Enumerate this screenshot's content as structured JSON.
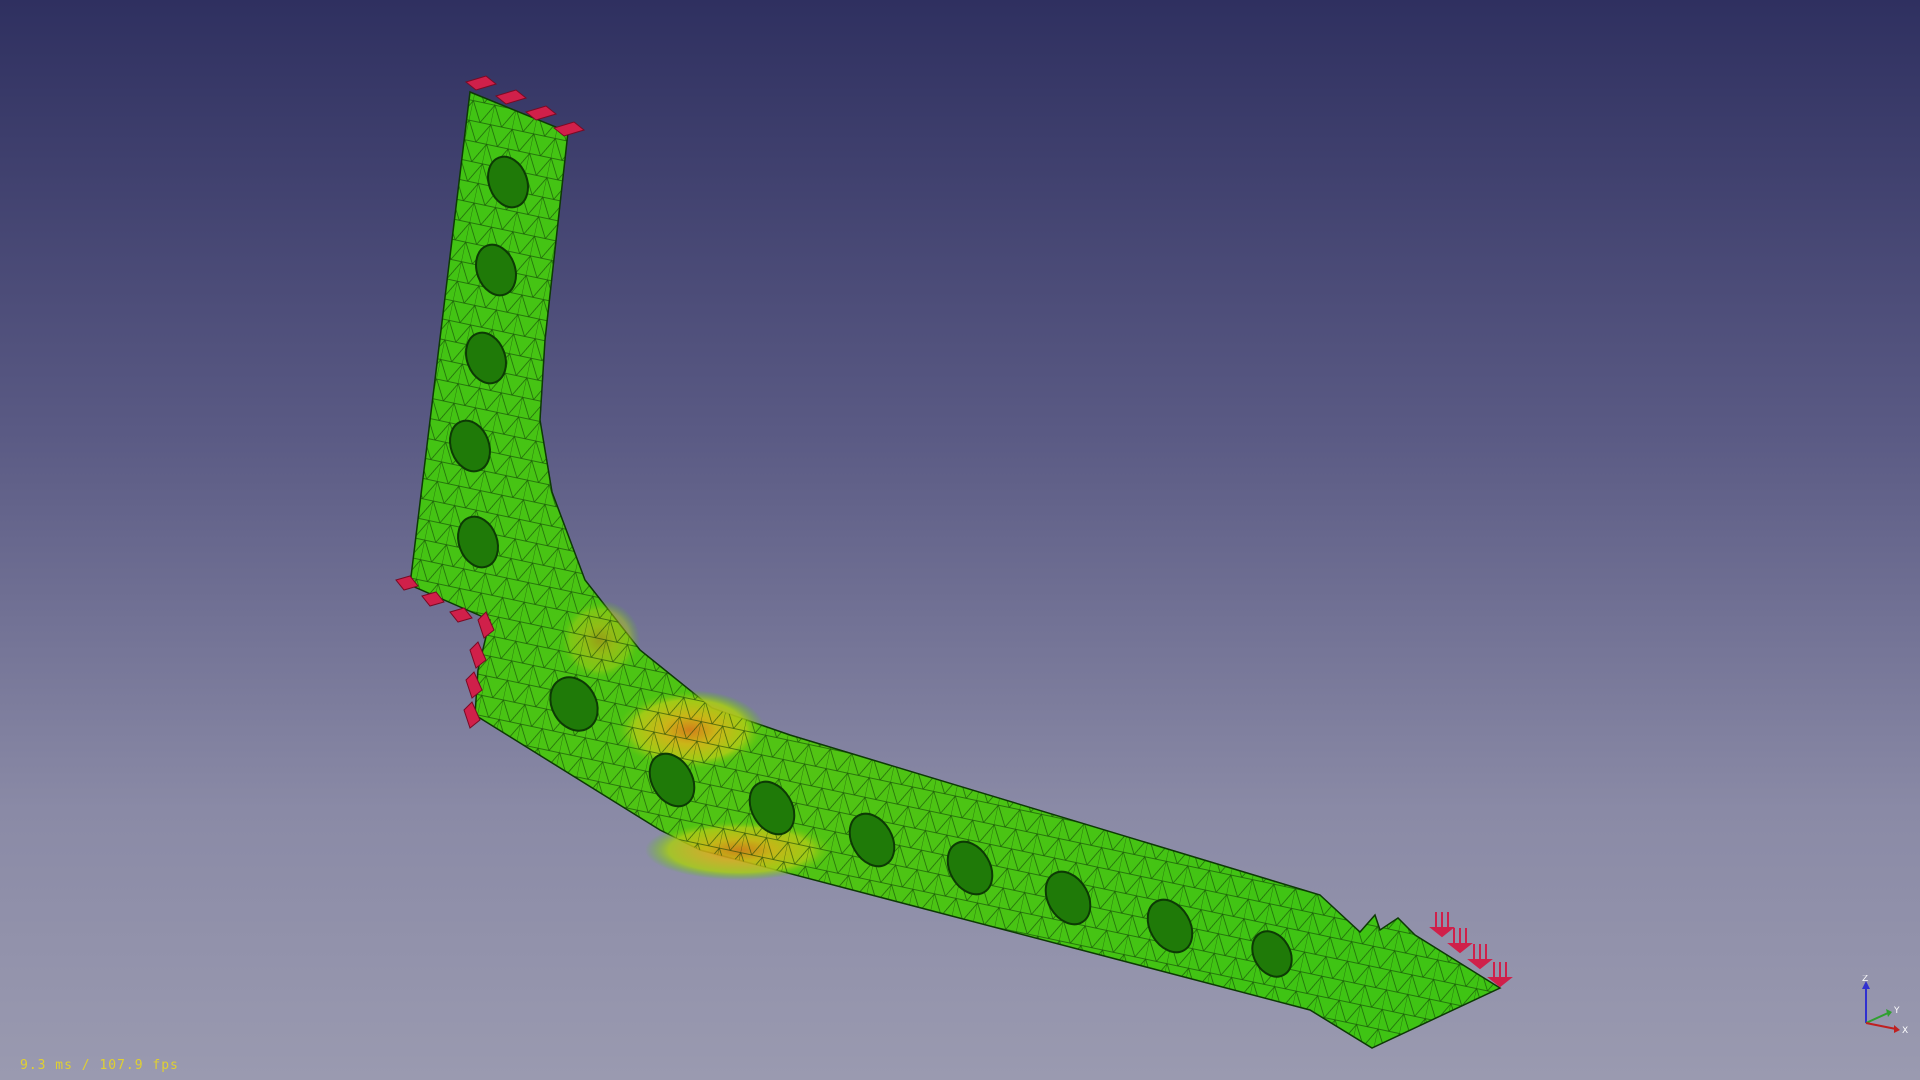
{
  "viewer": {
    "fps_label": "9.3 ms / 107.9 fps",
    "axes": {
      "x": "X",
      "y": "Y",
      "z": "Z"
    }
  },
  "colors": {
    "background_top": "#2f3060",
    "background_bottom": "#9a9ab0",
    "mesh_low_stress": "#3fc414",
    "mesh_mid_stress": "#d4d41a",
    "mesh_high_stress": "#e0781a",
    "constraint_markers": "#d0204a",
    "fps_text": "#e0d030"
  },
  "model": {
    "description_icon": "fem-bracket-mesh",
    "hole_count_vertical_arm": 5,
    "hole_count_horizontal_arm": 8
  }
}
